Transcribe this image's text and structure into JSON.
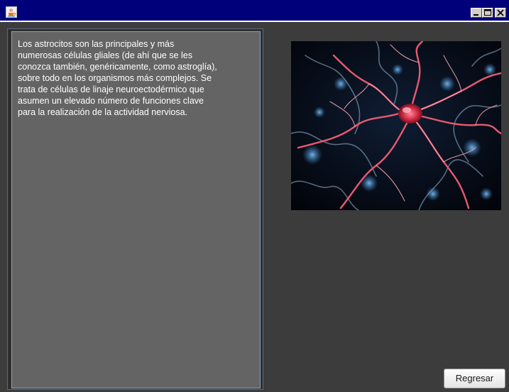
{
  "window": {
    "title": "",
    "app_icon": "java-cup-icon",
    "controls": {
      "minimize_icon": "minimize-icon",
      "maximize_icon": "maximize-icon",
      "close_icon": "close-icon"
    },
    "colors": {
      "titlebar": "#00007a",
      "background": "#3c3c3c"
    }
  },
  "content": {
    "description_text": "Los astrocitos son las principales y más\nnumerosas células gliales (de ahí que se les\nconozca también, genéricamente, como astroglía),\nsobre todo en los organismos más complejos. Se\ntrata de células de linaje neuroectodérmico que\nasumen un elevado número de funciones clave\npara la realización de la actividad nerviosa.",
    "image": {
      "subject": "neuron-cell-illustration",
      "colors": {
        "cell": "#d8324a",
        "glow": "#3a7fc0",
        "background": "#05070f"
      }
    }
  },
  "actions": {
    "back_label": "Regresar"
  }
}
